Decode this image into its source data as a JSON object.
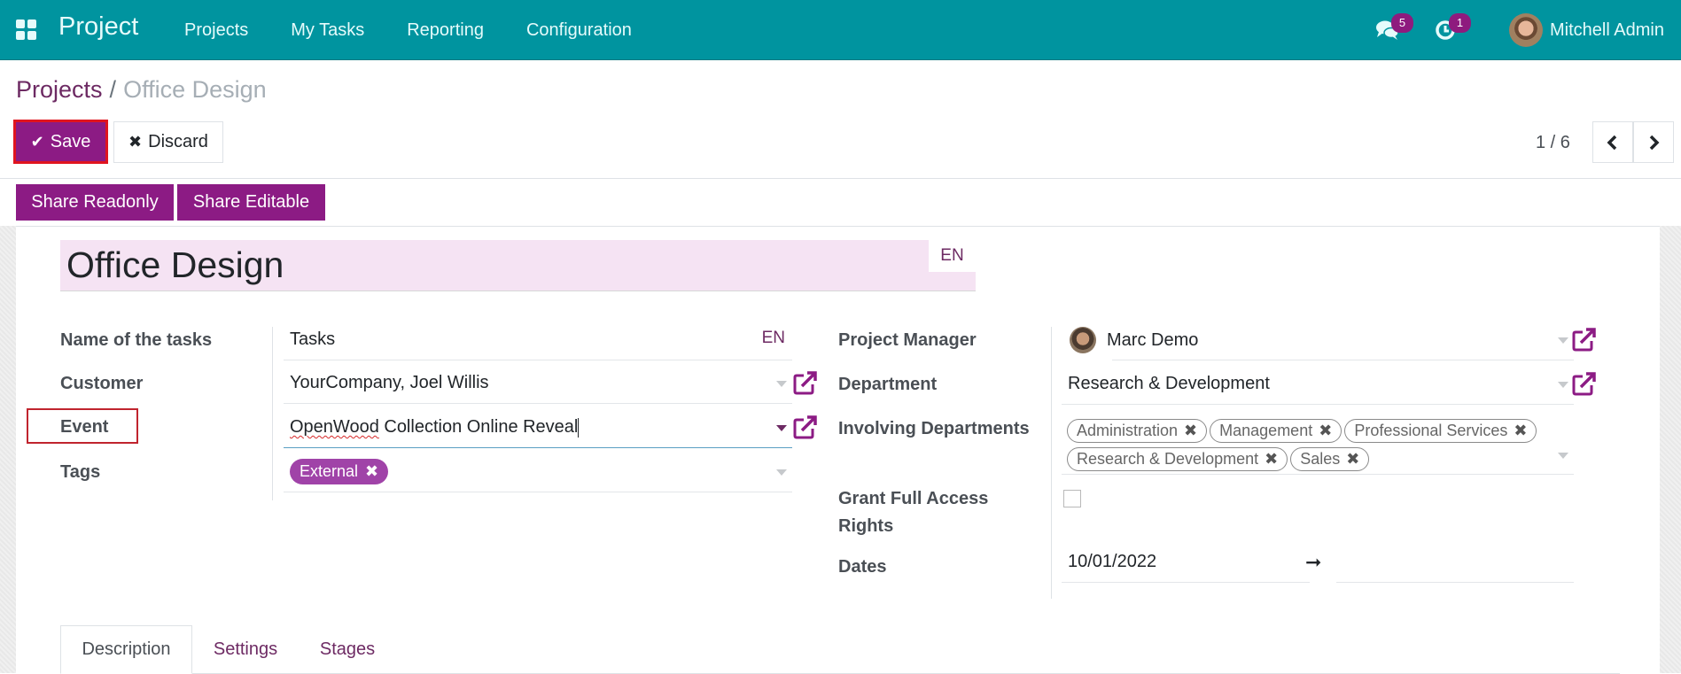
{
  "navbar": {
    "app_name": "Project",
    "menu": [
      "Projects",
      "My Tasks",
      "Reporting",
      "Configuration"
    ],
    "messages_count": "5",
    "activities_count": "1",
    "user_name": "Mitchell Admin",
    "icons": {
      "apps": "apps-grid-icon",
      "messages": "chat-bubbles-icon",
      "activities": "clock-icon"
    }
  },
  "breadcrumb": {
    "parent": "Projects",
    "separator": "/",
    "current": "Office Design"
  },
  "toolbar": {
    "save_label": "Save",
    "discard_label": "Discard",
    "pager": "1 / 6"
  },
  "actions": {
    "share_readonly": "Share Readonly",
    "share_editable": "Share Editable"
  },
  "form": {
    "title": "Office Design",
    "title_lang": "EN",
    "left": {
      "tasks_label": "Name of the tasks",
      "tasks_value": "Tasks",
      "tasks_lang": "EN",
      "customer_label": "Customer",
      "customer_value": "YourCompany, Joel Willis",
      "event_label": "Event",
      "event_value_word1": "OpenWood",
      "event_value_rest": " Collection Online Reveal",
      "tags_label": "Tags",
      "tags": [
        "External"
      ]
    },
    "right": {
      "manager_label": "Project Manager",
      "manager_value": "Marc Demo",
      "department_label": "Department",
      "department_value": "Research & Development",
      "involving_label": "Involving Departments",
      "involving": [
        "Administration",
        "Management",
        "Professional Services",
        "Research & Development",
        "Sales"
      ],
      "grant_label": "Grant Full Access Rights",
      "grant_checked": false,
      "dates_label": "Dates",
      "date_start": "10/01/2022",
      "date_end": ""
    }
  },
  "tabs": [
    {
      "label": "Description",
      "active": true
    },
    {
      "label": "Settings",
      "active": false
    },
    {
      "label": "Stages",
      "active": false
    }
  ],
  "colors": {
    "navbar": "#00949f",
    "primary": "#8c1b84",
    "link": "#6d2a63",
    "highlight": "#e0141f"
  }
}
